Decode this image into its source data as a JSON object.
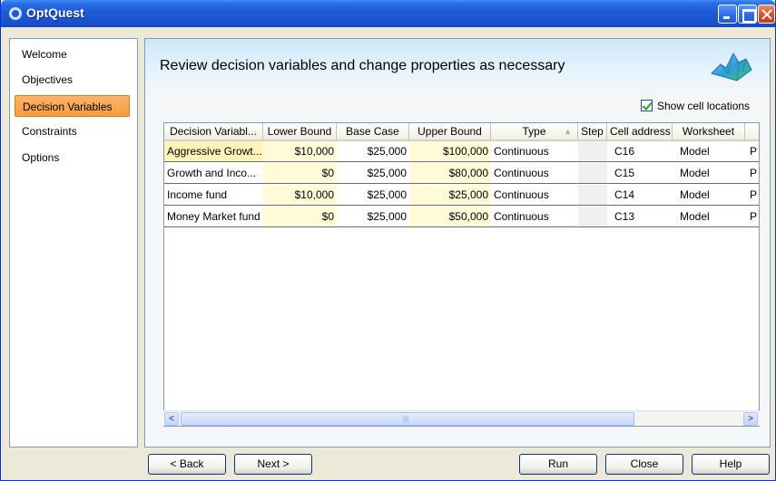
{
  "window": {
    "title": "OptQuest"
  },
  "nav": {
    "items": [
      {
        "label": "Welcome"
      },
      {
        "label": "Objectives"
      },
      {
        "label": "Decision Variables",
        "active": true
      },
      {
        "label": "Constraints"
      },
      {
        "label": "Options"
      }
    ]
  },
  "main": {
    "header": "Review decision variables and change properties as necessary",
    "show_cell_locations_label": "Show cell locations",
    "show_cell_locations_checked": true,
    "logo_icon": "mountain-surface-icon"
  },
  "grid": {
    "columns": [
      "Decision Variabl...",
      "Lower Bound",
      "Base Case",
      "Upper Bound",
      "Type",
      "Step",
      "Cell address",
      "Worksheet",
      ""
    ],
    "rows": [
      {
        "name": "Aggressive Growt...",
        "lower": "$10,000",
        "base": "$25,000",
        "upper": "$100,000",
        "type": "Continuous",
        "step": "",
        "cell": "C16",
        "sheet": "Model",
        "extra": "P"
      },
      {
        "name": "Growth and Inco...",
        "lower": "$0",
        "base": "$25,000",
        "upper": "$80,000",
        "type": "Continuous",
        "step": "",
        "cell": "C15",
        "sheet": "Model",
        "extra": "P"
      },
      {
        "name": "Income fund",
        "lower": "$10,000",
        "base": "$25,000",
        "upper": "$25,000",
        "type": "Continuous",
        "step": "",
        "cell": "C14",
        "sheet": "Model",
        "extra": "P"
      },
      {
        "name": "Money Market fund",
        "lower": "$0",
        "base": "$25,000",
        "upper": "$50,000",
        "type": "Continuous",
        "step": "",
        "cell": "C13",
        "sheet": "Model",
        "extra": "P"
      }
    ]
  },
  "buttons": {
    "back": "< Back",
    "next": "Next >",
    "run": "Run",
    "close": "Close",
    "help": "Help"
  },
  "colors": {
    "title_bar": "#1f5bd8",
    "nav_active": "#f79d3e",
    "bound_cell": "#fffbd9",
    "header_band": "#cfe8fa"
  }
}
